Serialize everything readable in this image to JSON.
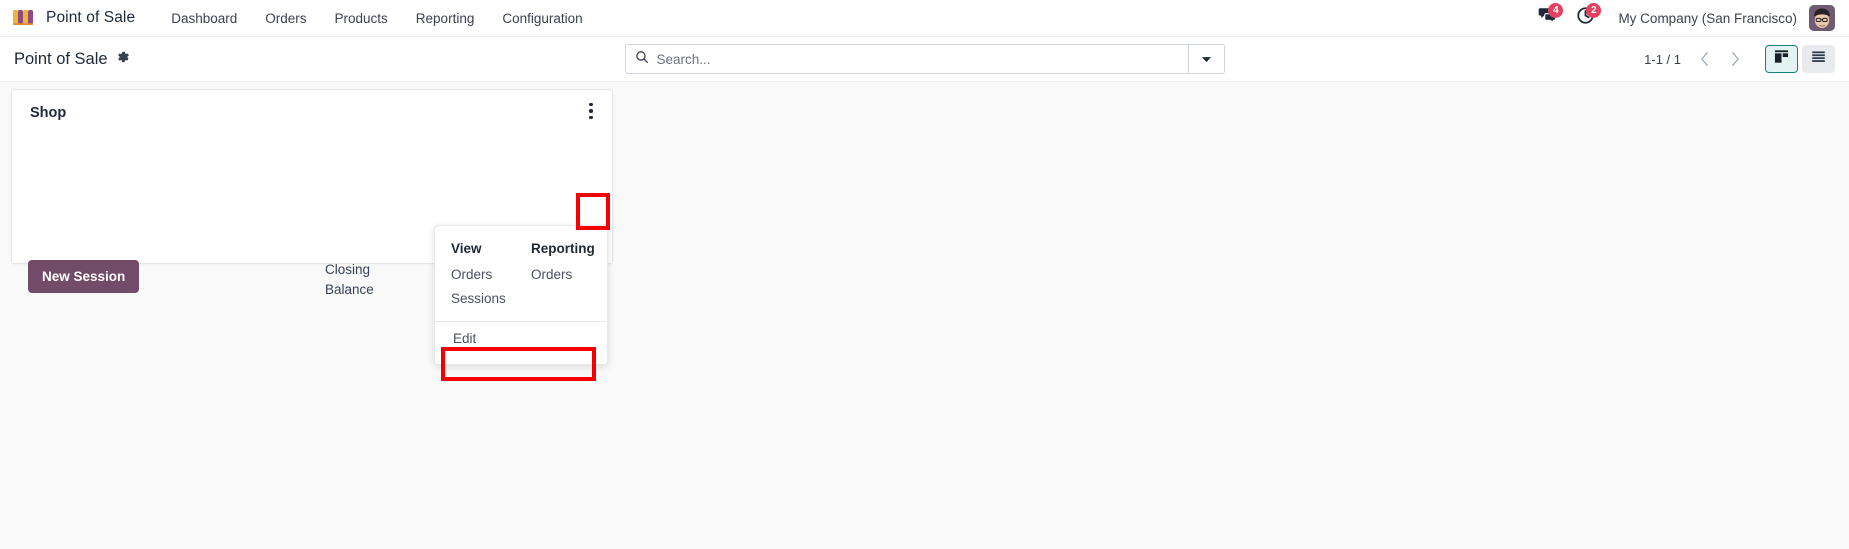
{
  "navbar": {
    "logo_icon": "shop-awning-icon",
    "app_name": "Point of Sale",
    "menu_items": [
      {
        "label": "Dashboard"
      },
      {
        "label": "Orders"
      },
      {
        "label": "Products"
      },
      {
        "label": "Reporting"
      },
      {
        "label": "Configuration"
      }
    ],
    "messages": {
      "icon": "chat-bubble-icon",
      "count": "4"
    },
    "activities": {
      "icon": "clock-icon",
      "count": "2"
    },
    "company": "My Company (San Francisco)",
    "avatar_icon": "user-avatar"
  },
  "control_panel": {
    "title": "Point of Sale",
    "settings_icon": "gear-icon",
    "search": {
      "icon": "search-icon",
      "value": "",
      "placeholder": "Search...",
      "toggle_icon": "caret-down-icon"
    },
    "pager": {
      "value": "1-1 / 1",
      "prev_icon": "chevron-left-icon",
      "next_icon": "chevron-right-icon"
    },
    "view_switcher": [
      {
        "name": "kanban",
        "icon": "kanban-view-icon",
        "active": true
      },
      {
        "name": "list",
        "icon": "list-view-icon",
        "active": false
      }
    ]
  },
  "kanban": {
    "card": {
      "title": "Shop",
      "menu_icon": "vertical-dots-icon",
      "new_session_label": "New Session",
      "closing_balance_label": "Closing Balance"
    },
    "dropdown": {
      "columns": [
        {
          "header": "View",
          "items": [
            {
              "label": "Orders"
            },
            {
              "label": "Sessions"
            }
          ]
        },
        {
          "header": "Reporting",
          "items": [
            {
              "label": "Orders"
            }
          ]
        }
      ],
      "edit_label": "Edit"
    }
  },
  "colors": {
    "brand_purple": "#714B67",
    "badge_red": "#E4405F",
    "annotation_red": "#F50000",
    "active_teal": "#1A7F7F",
    "page_bg": "#F9F9F9"
  }
}
